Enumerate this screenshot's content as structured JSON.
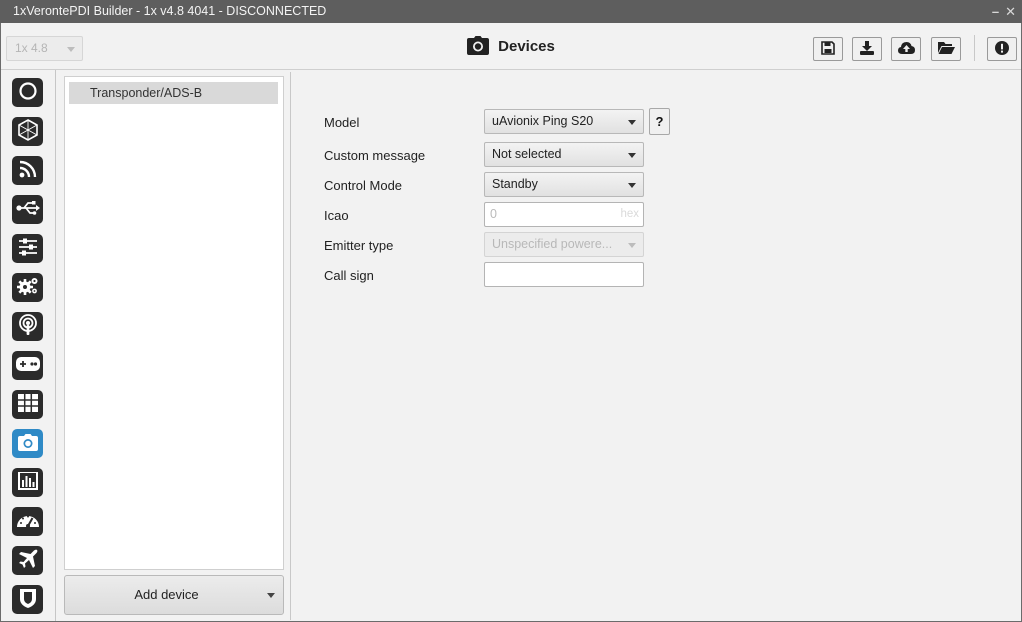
{
  "window": {
    "title": "1xVerontePDI Builder - 1x v4.8 4041 - DISCONNECTED",
    "minimize": "–",
    "close": "✕"
  },
  "topbar": {
    "version_value": "1x 4.8",
    "title": "Devices",
    "title_icon": "camera-icon",
    "buttons": [
      "save-icon",
      "download-icon",
      "cloud-upload-icon",
      "folder-open-icon",
      "alert-icon"
    ]
  },
  "sidebar": {
    "active_index": 9,
    "active_color": "#2f8ac6",
    "items": [
      "power-icon",
      "hexagon-icon",
      "rss-icon",
      "usb-icon",
      "sliders-icon",
      "gears-icon",
      "podcast-icon",
      "gamepad-icon",
      "grid-icon",
      "camera-icon",
      "bar-chart-icon",
      "dashboard-icon",
      "airplane-icon",
      "shield-icon"
    ]
  },
  "device_list": {
    "items": [
      "Transponder/ADS-B"
    ],
    "add_button": "Add device"
  },
  "form": {
    "model_label": "Model",
    "model_value": "uAvionix Ping S20",
    "help_label": "?",
    "custom_message_label": "Custom message",
    "custom_message_value": "Not selected",
    "control_mode_label": "Control Mode",
    "control_mode_value": "Standby",
    "icao_label": "Icao",
    "icao_value": "0",
    "icao_unit": "hex",
    "emitter_type_label": "Emitter type",
    "emitter_type_value": "Unspecified powere...",
    "call_sign_label": "Call sign",
    "call_sign_value": ""
  }
}
